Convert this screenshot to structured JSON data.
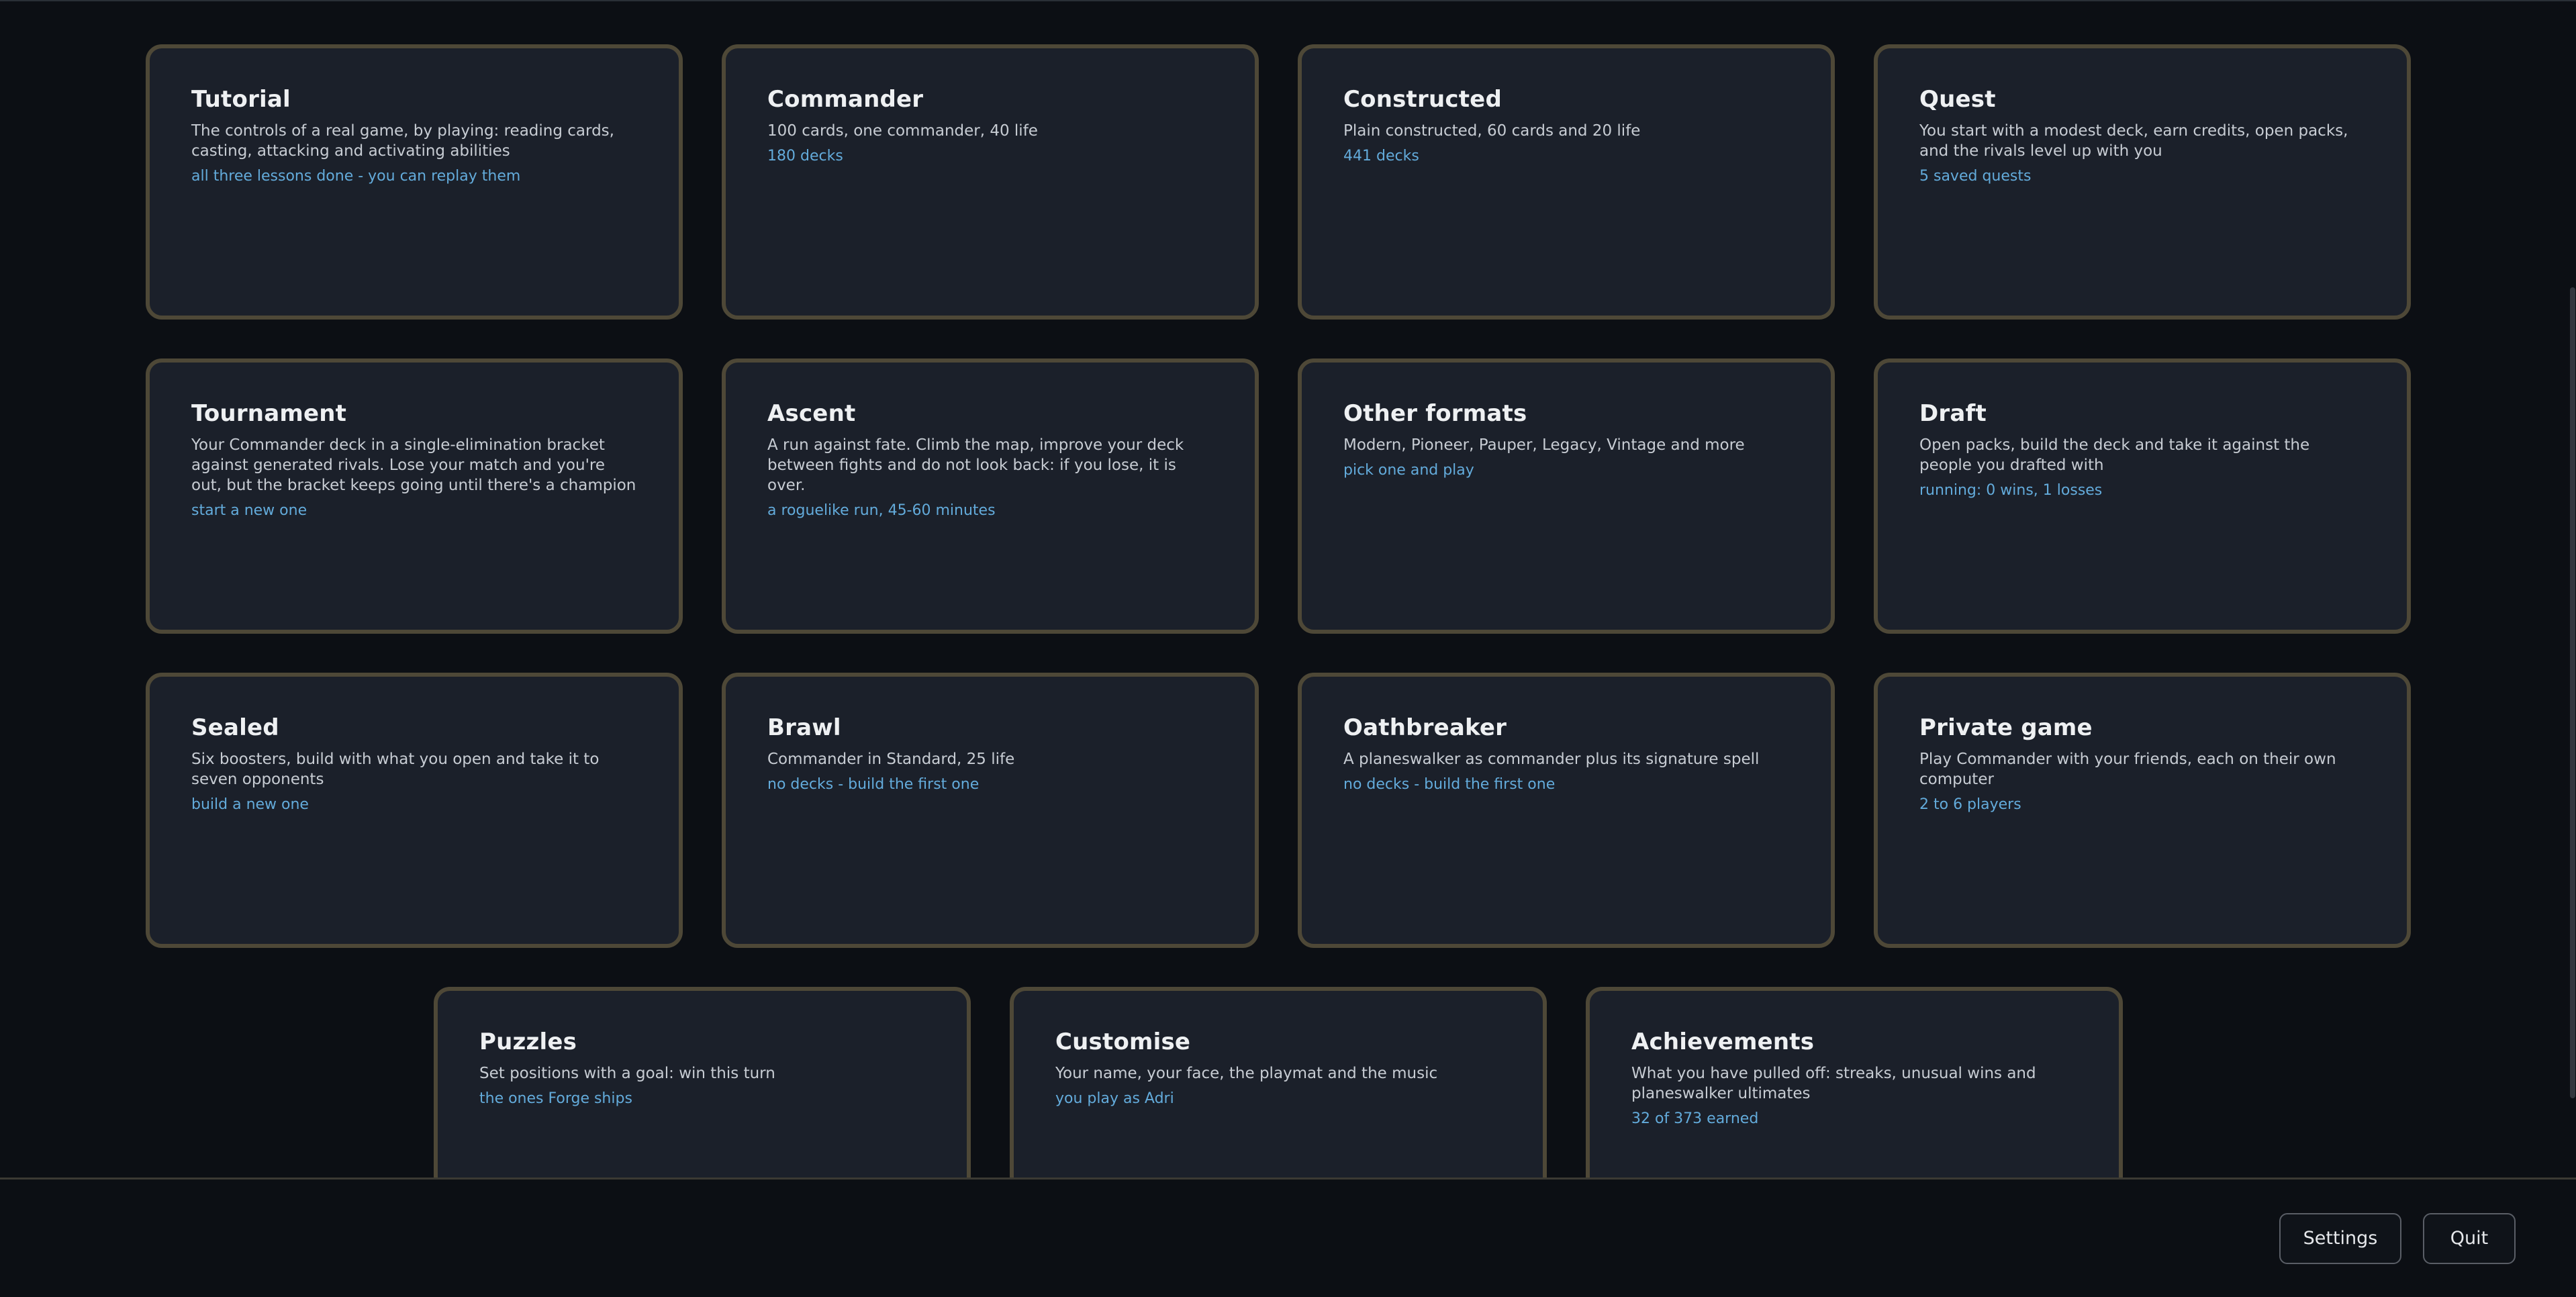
{
  "cards": [
    {
      "title": "Tutorial",
      "description": "The controls of a real game, by playing: reading cards, casting, attacking and activating abilities",
      "status": "all three lessons done - you can replay them"
    },
    {
      "title": "Commander",
      "description": "100 cards, one commander, 40 life",
      "status": "180 decks"
    },
    {
      "title": "Constructed",
      "description": "Plain constructed, 60 cards and 20 life",
      "status": "441 decks"
    },
    {
      "title": "Quest",
      "description": "You start with a modest deck, earn credits, open packs, and the rivals level up with you",
      "status": "5 saved quests"
    },
    {
      "title": "Tournament",
      "description": "Your Commander deck in a single-elimination bracket against generated rivals. Lose your match and you're out, but the bracket keeps going until there's a champion",
      "status": "start a new one"
    },
    {
      "title": "Ascent",
      "description": "A run against fate. Climb the map, improve your deck between fights and do not look back: if you lose, it is over.",
      "status": "a roguelike run, 45-60 minutes"
    },
    {
      "title": "Other formats",
      "description": "Modern, Pioneer, Pauper, Legacy, Vintage and more",
      "status": "pick one and play"
    },
    {
      "title": "Draft",
      "description": "Open packs, build the deck and take it against the people you drafted with",
      "status": "running: 0 wins, 1 losses"
    },
    {
      "title": "Sealed",
      "description": "Six boosters, build with what you open and take it to seven opponents",
      "status": "build a new one"
    },
    {
      "title": "Brawl",
      "description": "Commander in Standard, 25 life",
      "status": "no decks - build the first one"
    },
    {
      "title": "Oathbreaker",
      "description": "A planeswalker as commander plus its signature spell",
      "status": "no decks - build the first one"
    },
    {
      "title": "Private game",
      "description": "Play Commander with your friends, each on their own computer",
      "status": "2 to 6 players"
    },
    {
      "title": "Puzzles",
      "description": "Set positions with a goal: win this turn",
      "status": "the ones Forge ships"
    },
    {
      "title": "Customise",
      "description": "Your name, your face, the playmat and the music",
      "status": "you play as Adri"
    },
    {
      "title": "Achievements",
      "description": "What you have pulled off: streaks, unusual wins and planeswalker ultimates",
      "status": "32 of 373 earned"
    }
  ],
  "footer": {
    "settings_label": "Settings",
    "quit_label": "Quit"
  },
  "colors": {
    "background": "#0c0f14",
    "card_background": "#1b202a",
    "card_border": "#4e4837",
    "title_text": "#eef0f2",
    "description_text": "#c7ccd3",
    "status_text": "#63abdb"
  }
}
